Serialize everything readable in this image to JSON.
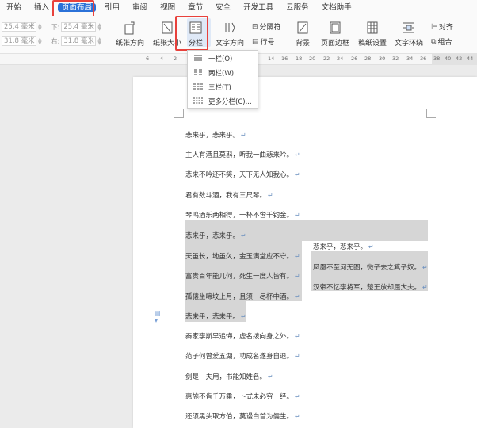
{
  "menu": {
    "items": [
      "开始",
      "插入",
      "页面布局",
      "引用",
      "审阅",
      "视图",
      "章节",
      "安全",
      "开发工具",
      "云服务",
      "文档助手"
    ],
    "active_index": 2
  },
  "ribbon": {
    "margins": {
      "top_value": "25.4 毫米",
      "bottom_label": "下:",
      "bottom_value": "25.4 毫米",
      "left_value": "31.8 毫米",
      "right_label": "右:",
      "right_value": "31.8 毫米"
    },
    "buttons": {
      "orientation": "纸张方向",
      "size": "纸张大小",
      "columns": "分栏",
      "text_direction": "文字方向",
      "separator": "分隔符",
      "line_number": "行号",
      "background": "背景",
      "page_border": "页面边框",
      "paper_setup": "稿纸设置",
      "wrap_text": "文字环绕",
      "align": "对齐",
      "group": "组合"
    }
  },
  "ruler": {
    "numbers": [
      "6",
      "4",
      "2",
      "14",
      "16",
      "18",
      "20",
      "22",
      "24",
      "26",
      "28",
      "30",
      "32",
      "34",
      "36",
      "38",
      "40",
      "42",
      "44",
      "46"
    ]
  },
  "columns_menu": {
    "items": [
      "一栏(O)",
      "两栏(W)",
      "三栏(T)",
      "更多分栏(C)..."
    ]
  },
  "document": {
    "lines_before": [
      "悲来乎，悲来乎。",
      "主人有酒且莫斟，听我一曲悲来吟。",
      "悲来不吟还不笑，天下无人知我心。",
      "君有数斗酒，我有三尺琴。",
      "琴鸣酒乐两相得，一杯不啻千钧金。"
    ],
    "col1": [
      "悲来乎，悲来乎。",
      "天虽长，地虽久，金玉满堂应不守。",
      "富贵百年能几何，死生一度人皆有。",
      "孤猿坐啼坟上月，且须一尽杯中酒。",
      "悲来乎，悲来乎。"
    ],
    "col2": [
      "悲来乎，悲来乎。",
      "凤凰不至河无图，微子去之箕子奴。",
      "汉帝不忆李将军，楚王放却屈大夫。"
    ],
    "lines_after": [
      "秦家李斯早追悔，虚名拨向身之外。",
      "范子何曾爱五湖，功成名遂身自退。",
      "剑是一夫用，书能知姓名。",
      "惠施不肯千万乘，卜式未必穷一经。",
      "还须黑头取方伯，莫谩白首为儒生。"
    ],
    "para_mark": "↵"
  },
  "colors": {
    "accent": "#2b71d8",
    "highlight_box": "#e8413c",
    "selection": "#d6d6d6"
  }
}
